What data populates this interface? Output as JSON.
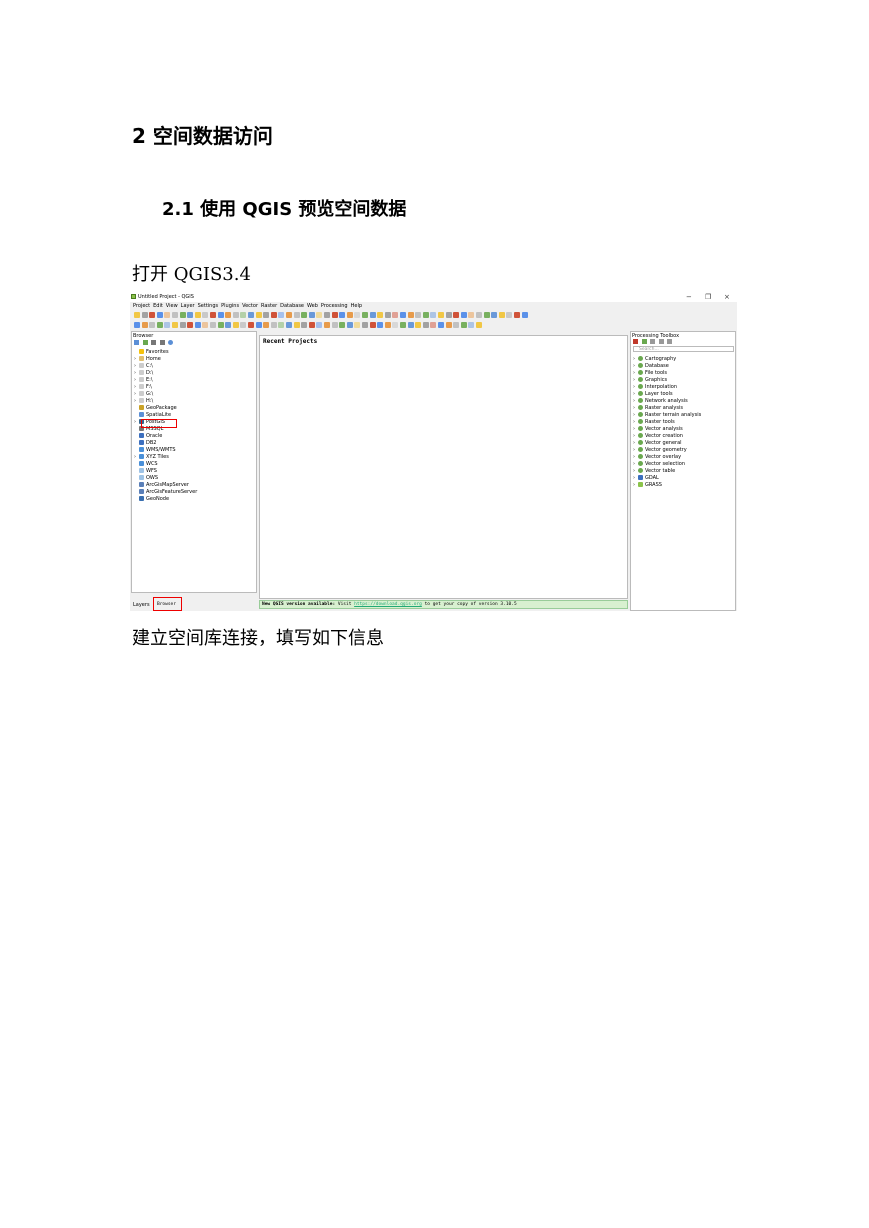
{
  "doc": {
    "heading1": "2  空间数据访问",
    "heading2": "2.1 使用 QGIS 预览空间数据",
    "para1": "打开 QGIS3.4",
    "para2": "建立空间库连接，填写如下信息"
  },
  "qgis": {
    "window_title": "Untitled Project - QGIS",
    "window_controls": [
      "−",
      "❐",
      "×"
    ],
    "menu": [
      "Project",
      "Edit",
      "View",
      "Layer",
      "Settings",
      "Plugins",
      "Vector",
      "Raster",
      "Database",
      "Web",
      "Processing",
      "Help"
    ],
    "browser_title": "Browser",
    "browser_items": [
      {
        "label": "Favorites",
        "arrow": "",
        "color": "#f4c20d"
      },
      {
        "label": "Home",
        "arrow": "›",
        "color": "#e0c070"
      },
      {
        "label": "C:\\",
        "arrow": "›",
        "color": "#cccccc"
      },
      {
        "label": "D:\\",
        "arrow": "›",
        "color": "#cccccc"
      },
      {
        "label": "E:\\",
        "arrow": "›",
        "color": "#cccccc"
      },
      {
        "label": "F:\\",
        "arrow": "›",
        "color": "#cccccc"
      },
      {
        "label": "G:\\",
        "arrow": "›",
        "color": "#cccccc"
      },
      {
        "label": "H:\\",
        "arrow": "›",
        "color": "#cccccc"
      },
      {
        "label": "GeoPackage",
        "arrow": "",
        "color": "#c9a227"
      },
      {
        "label": "SpatiaLite",
        "arrow": "",
        "color": "#5b8fd6"
      },
      {
        "label": "PostGIS",
        "arrow": "›",
        "color": "#336791"
      },
      {
        "label": "MSSQL",
        "arrow": "",
        "color": "#777777"
      },
      {
        "label": "Oracle",
        "arrow": "",
        "color": "#3c6fbf"
      },
      {
        "label": "DB2",
        "arrow": "",
        "color": "#3c6fbf"
      },
      {
        "label": "WMS/WMTS",
        "arrow": "",
        "color": "#4a90d9"
      },
      {
        "label": "XYZ Tiles",
        "arrow": "›",
        "color": "#4a90d9"
      },
      {
        "label": "WCS",
        "arrow": "",
        "color": "#4a90d9"
      },
      {
        "label": "WFS",
        "arrow": "",
        "color": "#9ec3e6"
      },
      {
        "label": "OWS",
        "arrow": "",
        "color": "#9ec3e6"
      },
      {
        "label": "ArcGisMapServer",
        "arrow": "",
        "color": "#5a7fb8"
      },
      {
        "label": "ArcGisFeatureServer",
        "arrow": "",
        "color": "#5a7fb8"
      },
      {
        "label": "GeoNode",
        "arrow": "",
        "color": "#3a6fb0"
      }
    ],
    "tab_layers": "Layers",
    "tab_browser": "Browser",
    "recent_projects": "Recent Projects",
    "status_bold": "New QGIS version available:",
    "status_text": " Visit ",
    "status_link": "https://download.qgis.org",
    "status_tail": " to get your copy of version 3.10.5",
    "toolbox_title": "Processing Toolbox",
    "toolbox_search": "Search...",
    "toolbox_items": [
      "Cartography",
      "Database",
      "File tools",
      "Graphics",
      "Interpolation",
      "Layer tools",
      "Network analysis",
      "Raster analysis",
      "Raster terrain analysis",
      "Raster tools",
      "Vector analysis",
      "Vector creation",
      "Vector general",
      "Vector geometry",
      "Vector overlay",
      "Vector selection",
      "Vector table",
      "GDAL",
      "GRASS"
    ]
  }
}
